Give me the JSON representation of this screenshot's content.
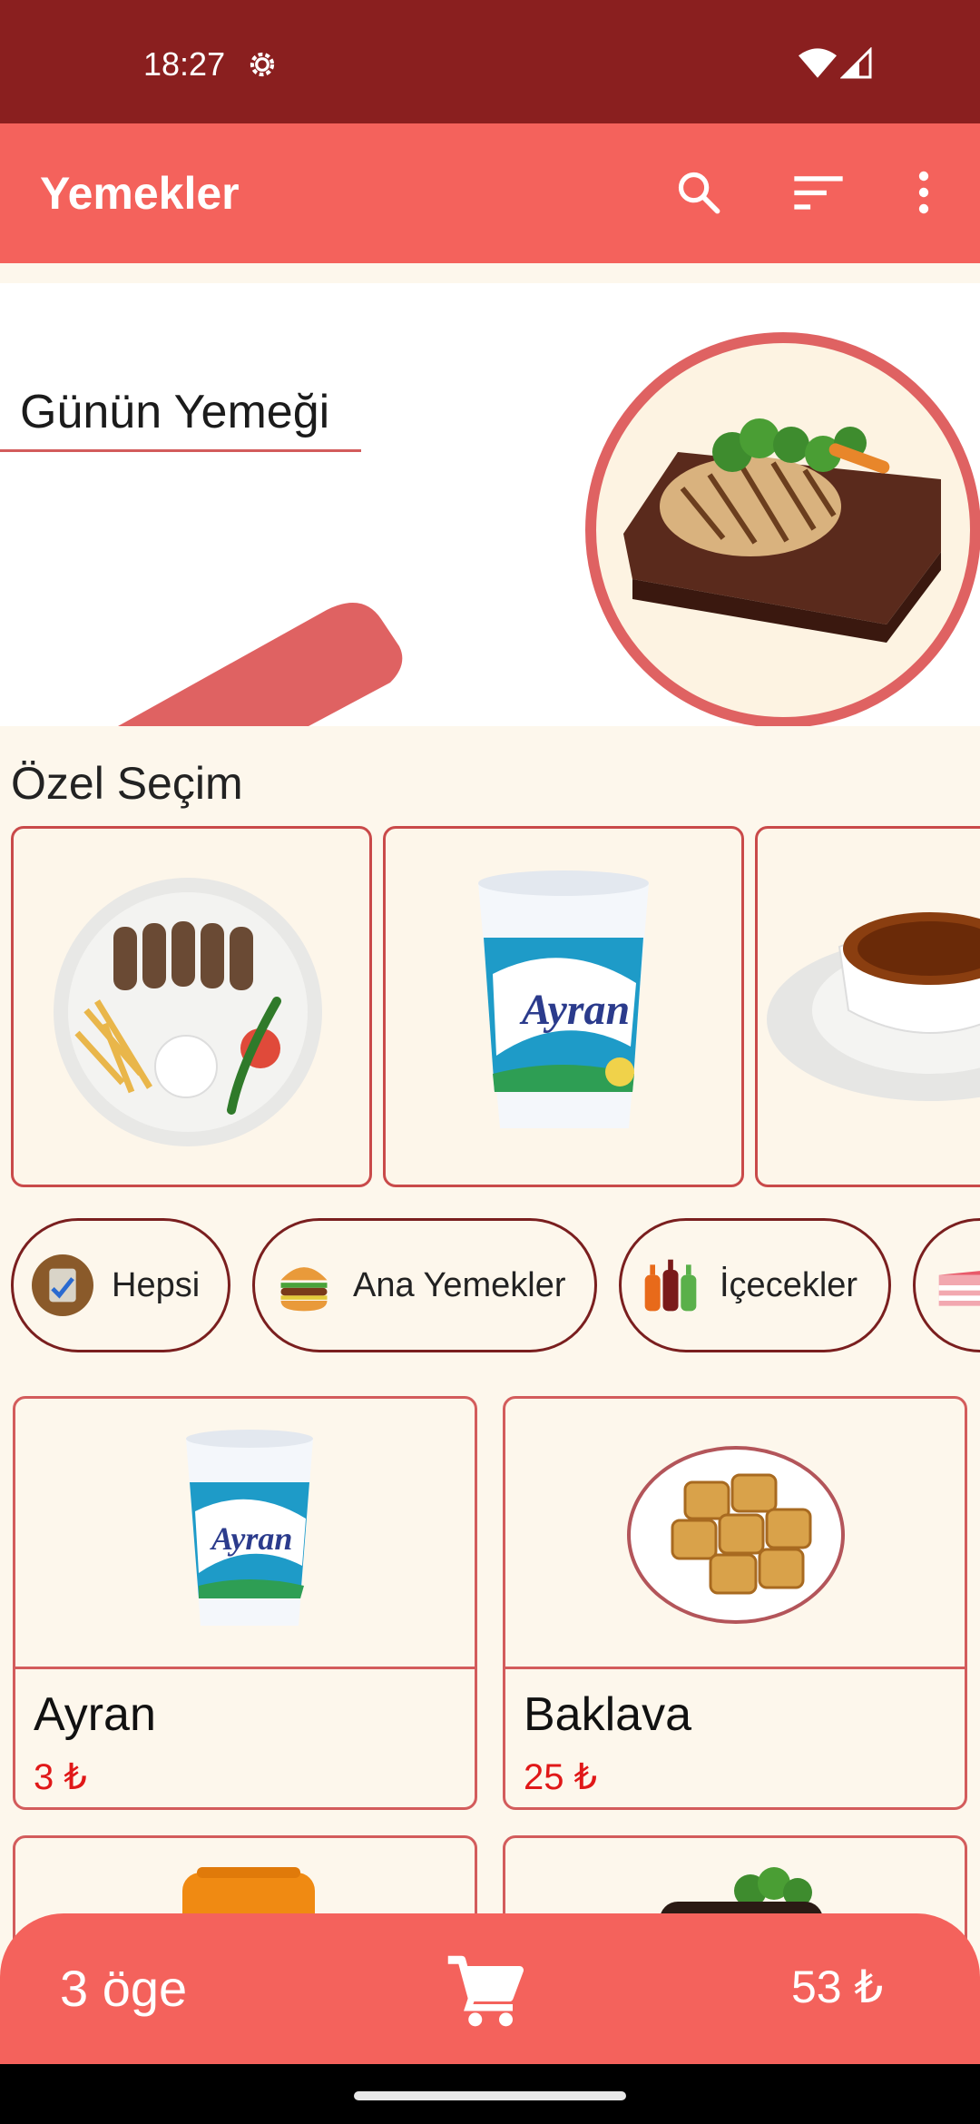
{
  "status_bar": {
    "time": "18:27"
  },
  "app_bar": {
    "title": "Yemekler"
  },
  "hero": {
    "label": "Günün Yemeği"
  },
  "special": {
    "title": "Özel Seçim",
    "items": [
      "Köfte tabağı",
      "Ayran",
      "Künefe"
    ]
  },
  "categories": [
    {
      "label": "Hepsi",
      "icon": "checklist-icon"
    },
    {
      "label": "Ana Yemekler",
      "icon": "burger-icon"
    },
    {
      "label": "İçecekler",
      "icon": "bottles-icon"
    },
    {
      "label": "",
      "icon": "cake-icon"
    }
  ],
  "products": [
    {
      "name": "Ayran",
      "price": "3 ₺"
    },
    {
      "name": "Baklava",
      "price": "25 ₺"
    }
  ],
  "cart": {
    "count": "3 öge",
    "total": "53 ₺"
  },
  "colors": {
    "primary": "#F4625C",
    "status": "#8A1F1F",
    "price": "#E01818",
    "background": "#FDF7EC"
  }
}
